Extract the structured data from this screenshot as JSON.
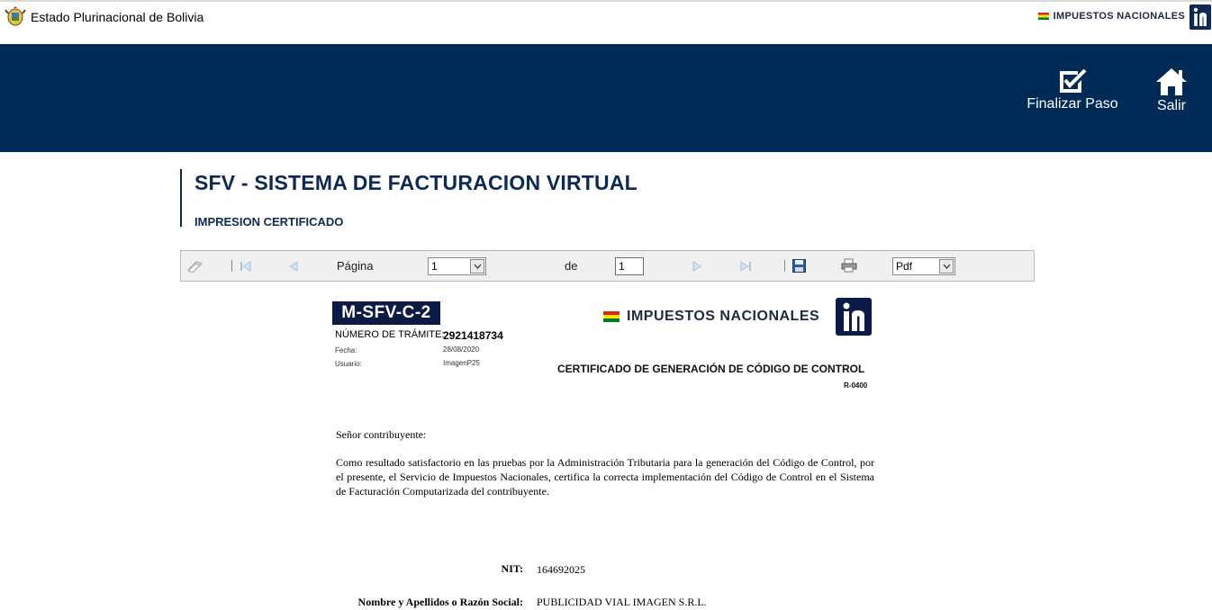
{
  "top_bar": {
    "state_name": "Estado Plurinacional de Bolivia",
    "brand": "IMPUESTOS NACIONALES"
  },
  "banner": {
    "finalize_label": "Finalizar Paso",
    "exit_label": "Salir",
    "background": "#002b57"
  },
  "header": {
    "title": "SFV - SISTEMA DE FACTURACION VIRTUAL",
    "subtitle": "IMPRESION CERTIFICADO"
  },
  "toolbar": {
    "page_label": "Página",
    "page_value": "1",
    "of_label": "de",
    "total_pages": "1",
    "format_value": "Pdf"
  },
  "document": {
    "form_code": "M-SFV-C-2",
    "tramite_label": "NÚMERO DE TRÁMITE:",
    "tramite_value": "2921418734",
    "fecha_label": "Fecha:",
    "fecha_value": "28/08/2020",
    "usuario_label": "Usuario:",
    "usuario_value": "ImagenP25",
    "brand": "IMPUESTOS NACIONALES",
    "cert_title": "CERTIFICADO DE GENERACIÓN DE CÓDIGO DE CONTROL",
    "cert_code": "R-0400",
    "greeting": "Señor contribuyente:",
    "body": "Como resultado satisfactorio en las pruebas por la Administración Tributaria para la generación del Código de Control, por el presente, el Servicio de Impuestos Nacionales, certifica la correcta implementación del Código de Control en el Sistema de Facturación Computarizada del contribuyente.",
    "nit_label": "NIT:",
    "nit_value": "164692025",
    "name_label": "Nombre y Apellidos o Razón Social:",
    "name_value": "PUBLICIDAD VIAL IMAGEN S.R.L."
  }
}
